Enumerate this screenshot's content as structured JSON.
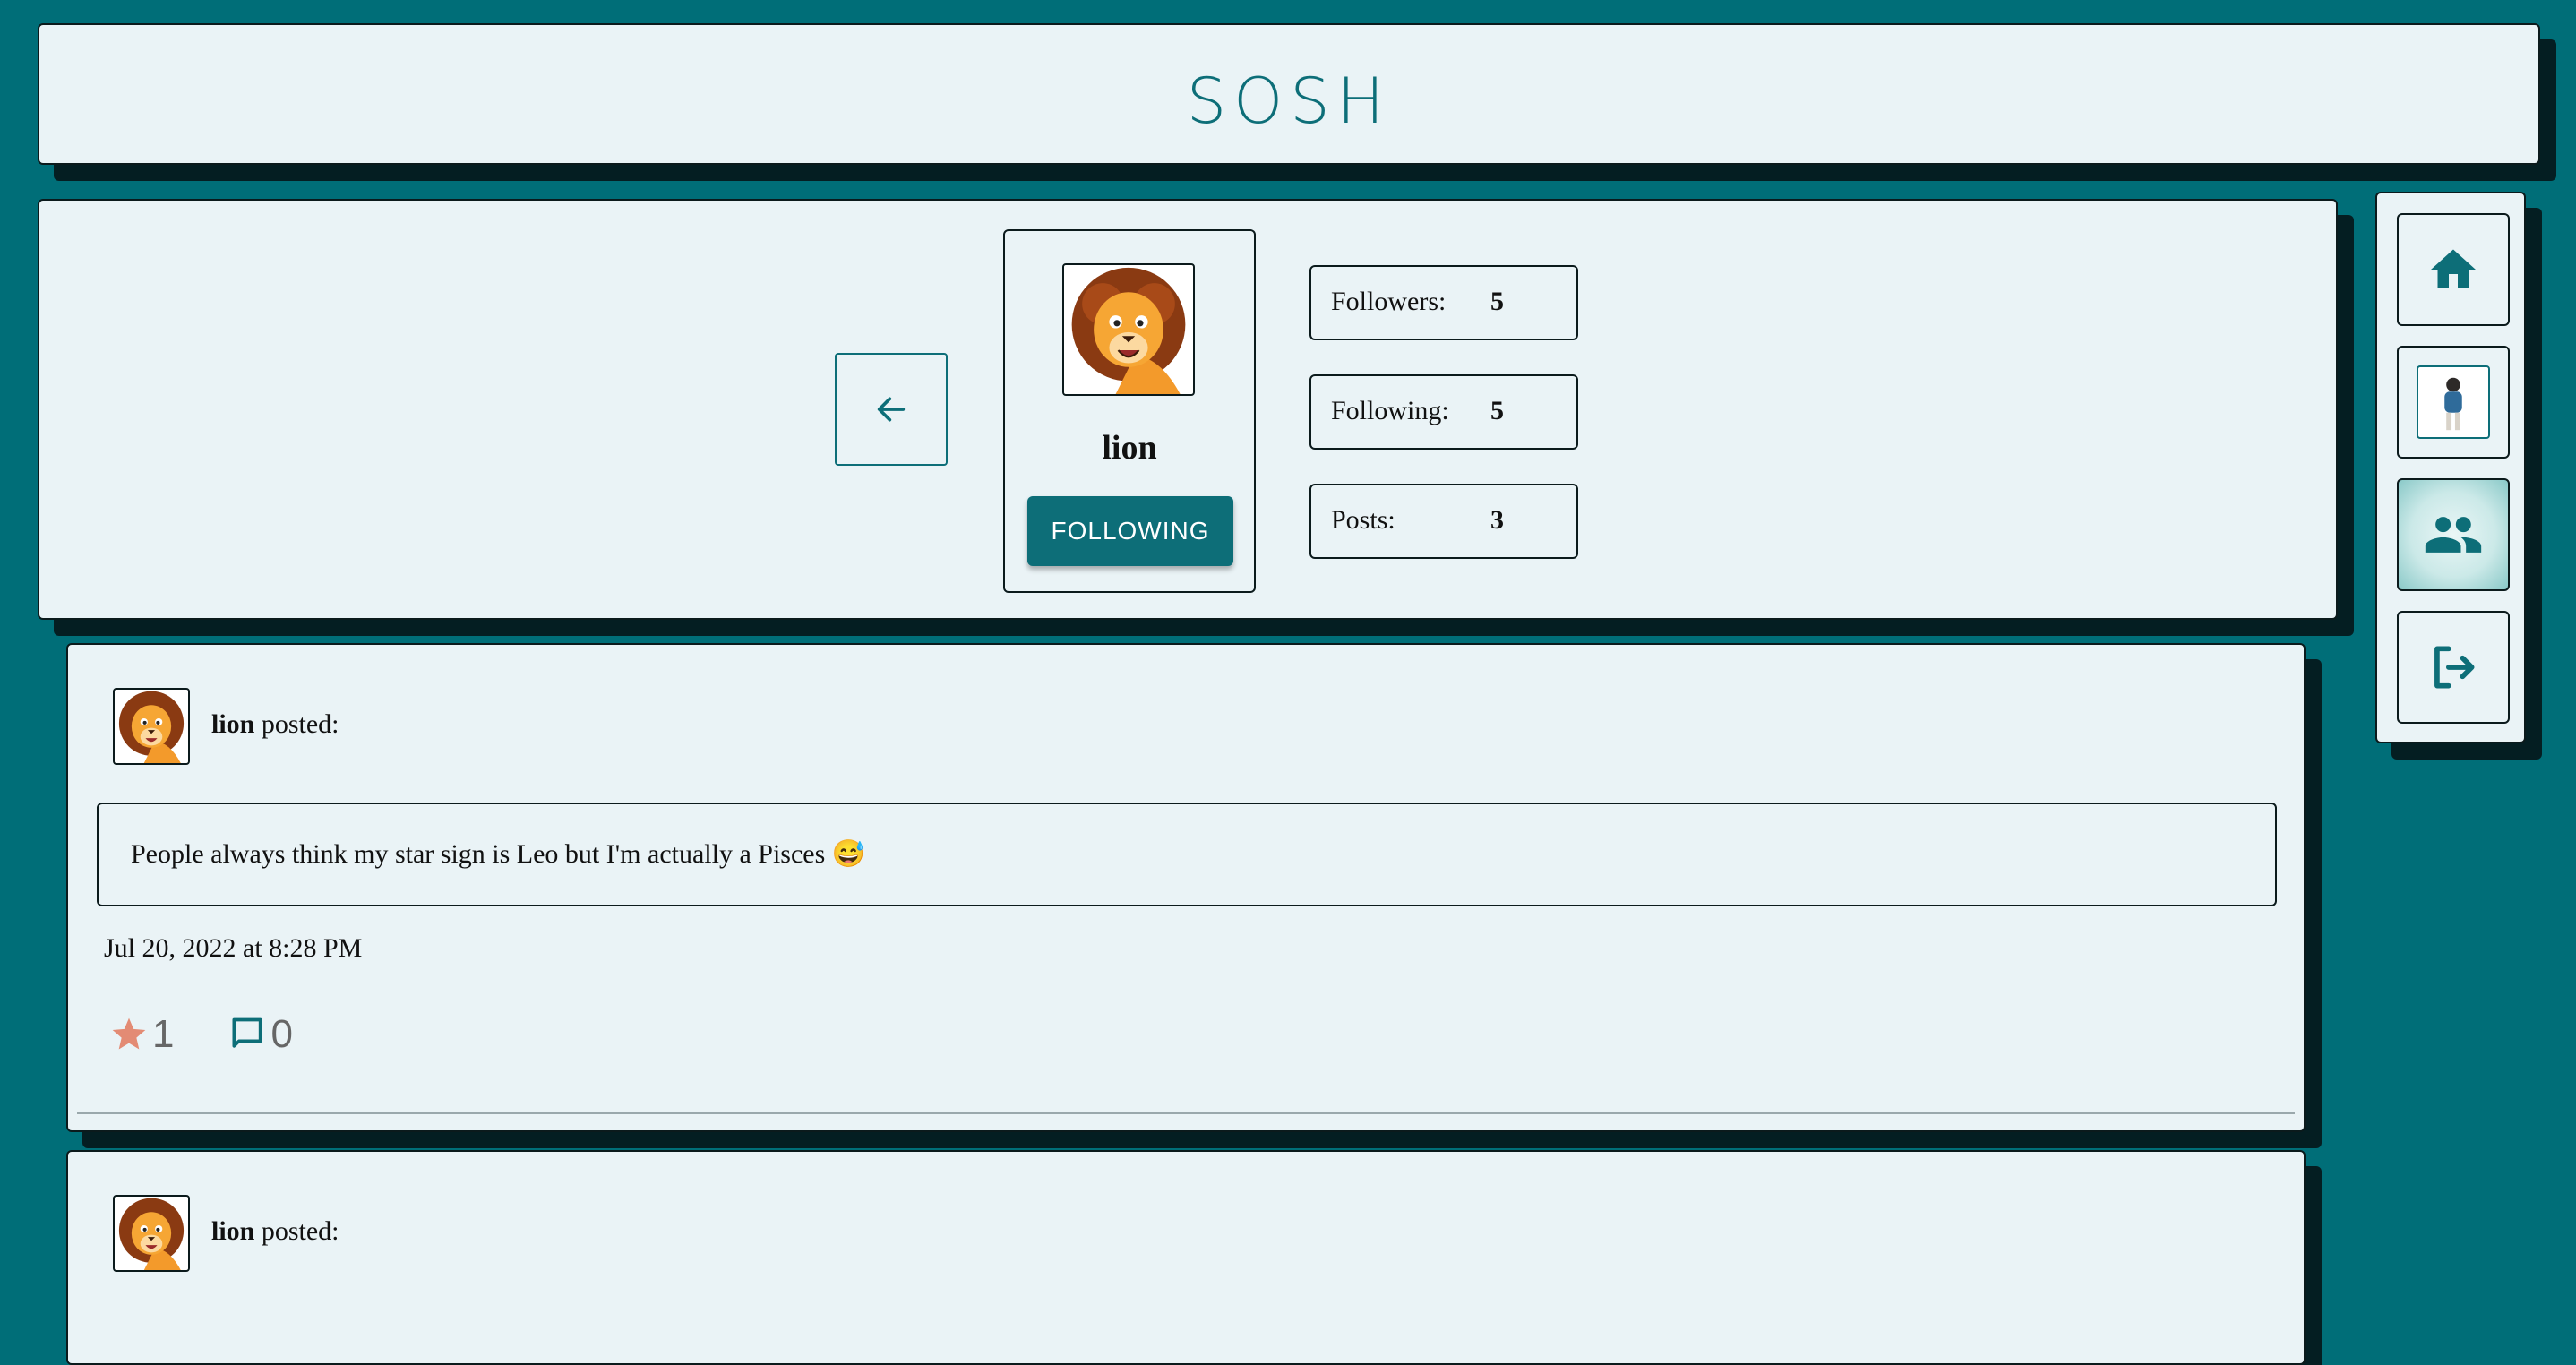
{
  "header": {
    "brand": "SOSH"
  },
  "profile": {
    "username": "lion",
    "follow_button_label": "FOLLOWING",
    "stats": [
      {
        "label": "Followers:",
        "value": "5"
      },
      {
        "label": "Following:",
        "value": "5"
      },
      {
        "label": "Posts:",
        "value": "3"
      }
    ]
  },
  "nav": {
    "items": [
      {
        "icon": "home-icon",
        "active": false
      },
      {
        "icon": "user-avatar",
        "active": false
      },
      {
        "icon": "people-icon",
        "active": true
      },
      {
        "icon": "logout-icon",
        "active": false
      }
    ]
  },
  "posts": [
    {
      "author": "lion",
      "posted_suffix": "posted:",
      "text": "People always think my star sign is Leo but I'm actually a Pisces 😅",
      "date": "Jul 20, 2022 at 8:28 PM",
      "stars": "1",
      "comments": "0"
    },
    {
      "author": "lion",
      "posted_suffix": "posted:"
    }
  ],
  "colors": {
    "background": "#006e78",
    "panel": "#eaf3f6",
    "accent": "#0d6e78",
    "star": "#e38b74"
  }
}
